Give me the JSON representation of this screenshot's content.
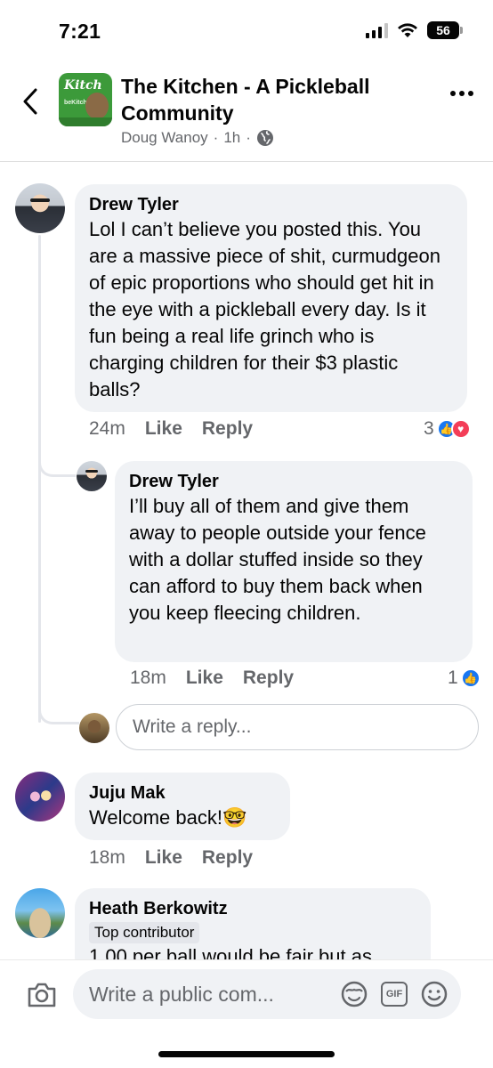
{
  "status_bar": {
    "time": "7:21",
    "battery": "56"
  },
  "header": {
    "group_name": "The Kitchen - A Pickleball Community",
    "logo_text": "Kitch",
    "logo_sub": "beKitchn",
    "author": "Doug Wanoy",
    "separator": "·",
    "time": "1h",
    "separator2": "·"
  },
  "comments": [
    {
      "author": "Drew Tyler",
      "text": "Lol I can’t believe you posted this. You are a massive piece of shit, curmudgeon of epic proportions who should get hit in the eye with a pickleball every day. Is it fun being a real life grinch who is charging children for their $3 plastic balls?",
      "time": "24m",
      "like_label": "Like",
      "reply_label": "Reply",
      "reaction_count": "3"
    },
    {
      "author": "Drew Tyler",
      "text": "I’ll buy all of them and give them away to people outside your fence with a dollar stuffed inside so they can afford to buy them back when you keep fleecing children.",
      "time": "18m",
      "like_label": "Like",
      "reply_label": "Reply",
      "reaction_count": "1"
    },
    {
      "author": "Juju Mak",
      "text": "Welcome back!🤓",
      "time": "18m",
      "like_label": "Like",
      "reply_label": "Reply"
    },
    {
      "author": "Heath Berkowitz",
      "badge": "Top contributor",
      "text": "1.00 per ball would be fair but as"
    }
  ],
  "reply_input": {
    "placeholder": "Write a reply..."
  },
  "composer": {
    "placeholder": "Write a public com...",
    "gif_label": "GIF"
  },
  "colors": {
    "like_blue": "#1877f2",
    "love_red": "#f33e58",
    "bubble_bg": "#f0f2f5",
    "meta_gray": "#65676b"
  }
}
